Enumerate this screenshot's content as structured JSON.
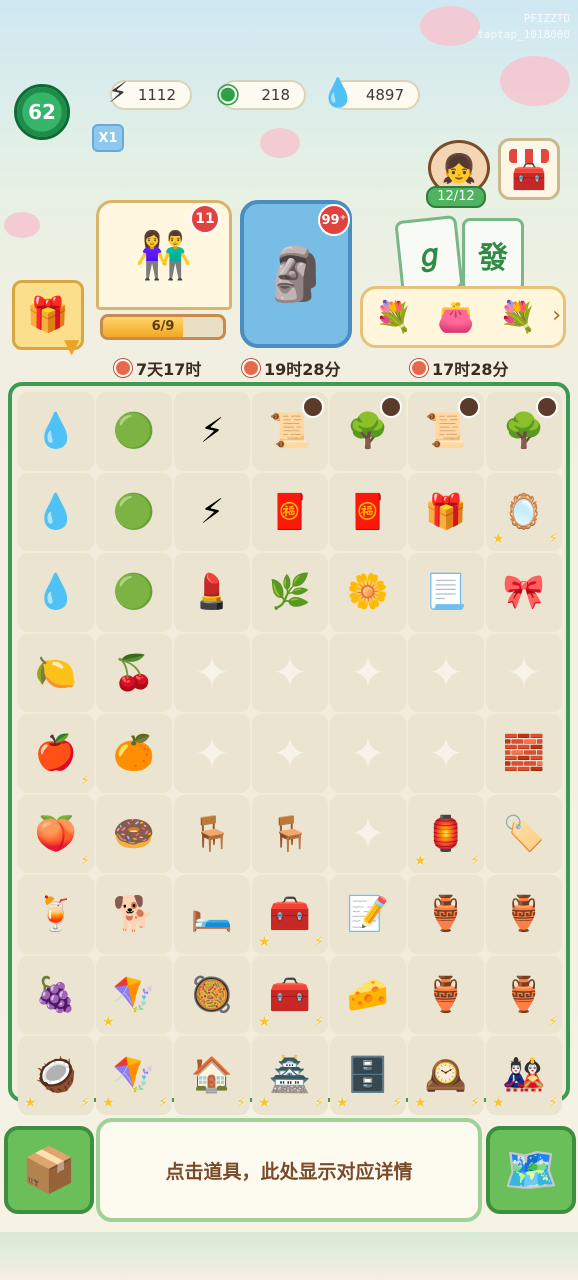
{
  "watermark": {
    "line1": "PFIZZTD",
    "line2": "taptap_1018000"
  },
  "header": {
    "level": "62",
    "gold": "1112",
    "jade": "218",
    "water": "4897",
    "multiplier": "X1"
  },
  "scene": {
    "avatar_count": "12/12",
    "mahjong_tiles": [
      "𝑔",
      "發"
    ],
    "couple_badge": "11",
    "progress_label": "6/9",
    "progress": 0.667,
    "statue_badge": "99⁺"
  },
  "timers": [
    "7天17时",
    "19时28分",
    "17时28分"
  ],
  "board": {
    "rows": [
      [
        {
          "icon": "💧"
        },
        {
          "icon": "🟢"
        },
        {
          "icon": "⚡"
        },
        {
          "icon": "📜",
          "cd": true
        },
        {
          "icon": "🌳",
          "cd": true
        },
        {
          "icon": "📜",
          "cd": true
        },
        {
          "icon": "🌳",
          "cd": true
        }
      ],
      [
        {
          "icon": "💧"
        },
        {
          "icon": "🟢"
        },
        {
          "icon": "⚡"
        },
        {
          "icon": "🧧"
        },
        {
          "icon": "🧧"
        },
        {
          "icon": "🎁"
        },
        {
          "icon": "🪞",
          "spark": true,
          "bolt": true
        }
      ],
      [
        {
          "icon": "💧"
        },
        {
          "icon": "🟢"
        },
        {
          "icon": "💄"
        },
        {
          "icon": "🌿"
        },
        {
          "icon": "🌼"
        },
        {
          "icon": "📃"
        },
        {
          "icon": "🎀"
        }
      ],
      [
        {
          "icon": "🍋"
        },
        {
          "icon": "🍒"
        },
        {
          "icon": ""
        },
        {
          "icon": ""
        },
        {
          "icon": ""
        },
        {
          "icon": ""
        },
        {
          "icon": ""
        }
      ],
      [
        {
          "icon": "🍎",
          "bolt": true
        },
        {
          "icon": "🍊"
        },
        {
          "icon": ""
        },
        {
          "icon": ""
        },
        {
          "icon": ""
        },
        {
          "icon": ""
        },
        {
          "icon": "🧱"
        }
      ],
      [
        {
          "icon": "🍑",
          "bolt": true
        },
        {
          "icon": "🍩"
        },
        {
          "icon": "🪑"
        },
        {
          "icon": "🪑"
        },
        {
          "icon": ""
        },
        {
          "icon": "🏮",
          "spark": true,
          "bolt": true
        },
        {
          "icon": "🏷️"
        }
      ],
      [
        {
          "icon": "🍹"
        },
        {
          "icon": "🐕"
        },
        {
          "icon": "🛏️"
        },
        {
          "icon": "🧰",
          "spark": true,
          "bolt": true
        },
        {
          "icon": "📝"
        },
        {
          "icon": "🏺"
        },
        {
          "icon": "🏺"
        }
      ],
      [
        {
          "icon": "🍇"
        },
        {
          "icon": "🪁",
          "spark": true
        },
        {
          "icon": "🥘"
        },
        {
          "icon": "🧰",
          "spark": true,
          "bolt": true
        },
        {
          "icon": "🧀"
        },
        {
          "icon": "🏺"
        },
        {
          "icon": "🏺",
          "bolt": true
        }
      ],
      [
        {
          "icon": "🥥",
          "spark": true,
          "bolt": true
        },
        {
          "icon": "🪁",
          "spark": true,
          "bolt": true
        },
        {
          "icon": "🏠",
          "bolt": true
        },
        {
          "icon": "🏯",
          "spark": true,
          "bolt": true
        },
        {
          "icon": "🗄️",
          "spark": true,
          "bolt": true
        },
        {
          "icon": "🕰️",
          "spark": true,
          "bolt": true
        },
        {
          "icon": "🎎",
          "spark": true,
          "bolt": true
        }
      ]
    ]
  },
  "details_text": "点击道具，此处显示对应详情"
}
